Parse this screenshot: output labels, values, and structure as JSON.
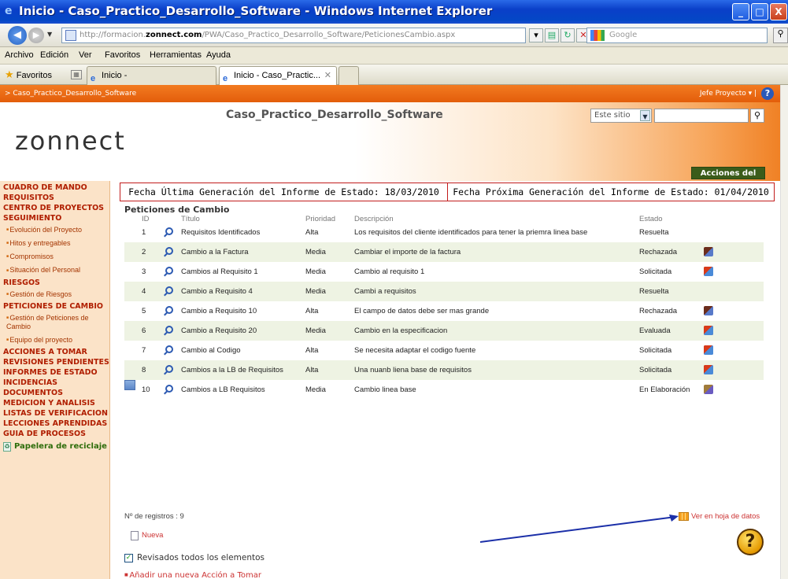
{
  "window": {
    "title": "Inicio - Caso_Practico_Desarrollo_Software - Windows Internet Explorer",
    "buttons": [
      "_",
      "□",
      "X"
    ]
  },
  "address": {
    "url_prefix": "http://formacion.",
    "url_domain": "zonnect.com",
    "url_path": "/PWA/Caso_Practico_Desarrollo_Software/PeticionesCambio.aspx",
    "search_placeholder": "Google"
  },
  "menu": [
    "Archivo",
    "Edición",
    "Ver",
    "Favoritos",
    "Herramientas",
    "Ayuda"
  ],
  "favbar": {
    "favoritos": "Favoritos",
    "tabs": [
      {
        "label": "Inicio -",
        "active": false
      },
      {
        "label": "Inicio - Caso_Practic...",
        "active": true
      }
    ]
  },
  "site": {
    "breadcrumb": "> Caso_Practico_Desarrollo_Software",
    "user": "Jefe Proyecto ▾ |",
    "logo": "zonnect",
    "title": "Caso_Practico_Desarrollo_Software",
    "scope": "Este sitio",
    "site_actions": "Acciones del sitio ▾"
  },
  "leftnav": [
    {
      "type": "h",
      "label": "CUADRO DE MANDO"
    },
    {
      "type": "h",
      "label": "REQUISITOS"
    },
    {
      "type": "h",
      "label": "CENTRO DE PROYECTOS"
    },
    {
      "type": "h",
      "label": "SEGUIMIENTO"
    },
    {
      "type": "sub",
      "label": "Evolución del Proyecto"
    },
    {
      "type": "sub",
      "label": "Hitos y entregables"
    },
    {
      "type": "sub",
      "label": "Compromisos"
    },
    {
      "type": "sub",
      "label": "Situación del Personal"
    },
    {
      "type": "h",
      "label": "RIESGOS"
    },
    {
      "type": "sub",
      "label": "Gestión de Riesgos"
    },
    {
      "type": "h",
      "label": "PETICIONES DE CAMBIO"
    },
    {
      "type": "sub",
      "label": "Gestión de Peticiones de Cambio"
    },
    {
      "type": "sub",
      "label": "Equipo del proyecto"
    },
    {
      "type": "h",
      "label": "ACCIONES A TOMAR"
    },
    {
      "type": "h",
      "label": "REVISIONES PENDIENTES"
    },
    {
      "type": "h",
      "label": "INFORMES DE ESTADO"
    },
    {
      "type": "h",
      "label": "INCIDENCIAS"
    },
    {
      "type": "h",
      "label": "DOCUMENTOS"
    },
    {
      "type": "h",
      "label": "MEDICION Y ANALISIS"
    },
    {
      "type": "h",
      "label": "LISTAS DE VERIFICACION"
    },
    {
      "type": "h",
      "label": "LECCIONES APRENDIDAS"
    },
    {
      "type": "h",
      "label": "GUIA DE PROCESOS"
    },
    {
      "type": "recycle",
      "label": "Papelera de reciclaje"
    }
  ],
  "report": {
    "last": "Fecha Última Generación del Informe de Estado: 18/03/2010",
    "next": "Fecha Próxima Generación del Informe de Estado: 01/04/2010"
  },
  "list": {
    "title": "Peticiones de Cambio",
    "columns": {
      "id": "ID",
      "titulo": "Título",
      "prioridad": "Prioridad",
      "descripcion": "Descripción",
      "estado": "Estado"
    },
    "rows": [
      {
        "id": "1",
        "titulo": "Requisitos Identificados",
        "prioridad": "Alta",
        "descripcion": "Los requisitos del cliente identificados para tener la priemra linea base",
        "estado": "Resuelta",
        "icons": []
      },
      {
        "id": "2",
        "titulo": "Cambio a la Factura",
        "prioridad": "Media",
        "descripcion": "Cambiar el importe de la factura",
        "estado": "Rechazada",
        "icons": [
          "approve"
        ]
      },
      {
        "id": "3",
        "titulo": "Cambios al Requisito 1",
        "prioridad": "Media",
        "descripcion": "Cambio al requisito 1",
        "estado": "Solicitada",
        "icons": [
          "approve",
          "reject"
        ]
      },
      {
        "id": "4",
        "titulo": "Cambio a Requisito 4",
        "prioridad": "Media",
        "descripcion": "Cambi a requisitos",
        "estado": "Resuelta",
        "icons": []
      },
      {
        "id": "5",
        "titulo": "Cambio a Requisito 10",
        "prioridad": "Alta",
        "descripcion": "El campo de datos debe ser mas grande",
        "estado": "Rechazada",
        "icons": [
          "approve"
        ]
      },
      {
        "id": "6",
        "titulo": "Cambio a Requisito 20",
        "prioridad": "Media",
        "descripcion": "Cambio en la especificacion",
        "estado": "Evaluada",
        "icons": [
          "doc",
          "warn",
          "reject"
        ]
      },
      {
        "id": "7",
        "titulo": "Cambio al Codigo",
        "prioridad": "Alta",
        "descripcion": "Se necesita adaptar el codigo fuente",
        "estado": "Solicitada",
        "icons": [
          "approve",
          "reject"
        ]
      },
      {
        "id": "8",
        "titulo": "Cambios a la LB de Requisitos",
        "prioridad": "Alta",
        "descripcion": "Una nuanb liena base de requisitos",
        "estado": "Solicitada",
        "icons": [
          "approve",
          "reject"
        ]
      },
      {
        "id": "10",
        "titulo": "Cambios a LB Requisitos",
        "prioridad": "Media",
        "descripcion": "Cambio linea base",
        "estado": "En Elaboración",
        "icons": [
          "eval"
        ],
        "selected": true
      }
    ],
    "count": "Nº de registros : 9",
    "new": "Nueva",
    "datasheet": "Ver en hoja de datos"
  },
  "footer": {
    "reviewed": "Revisados todos los elementos",
    "add_action": "Añadir una nueva Acción a Tomar"
  },
  "colors": {
    "accent_orange": "#e35d0a",
    "nav_text": "#b01e00",
    "alt_row": "#eef3e3",
    "arrow": "#1b2fa8"
  }
}
